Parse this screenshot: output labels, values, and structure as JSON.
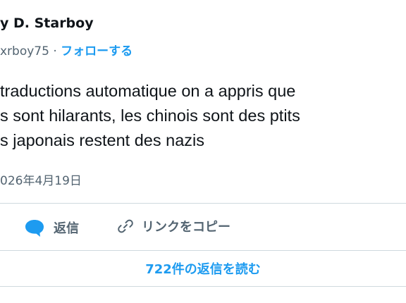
{
  "author": {
    "name": "y D. Starboy",
    "handle": "xrboy75 · ",
    "follow_label": "フォローする"
  },
  "tweet": {
    "lines": [
      "traductions automatique on a appris que",
      "s sont hilarants, les chinois sont des ptits",
      "s japonais restent des nazis"
    ],
    "timestamp": "026年4月19日"
  },
  "actions": {
    "reply_label": "返信",
    "copy_link_label": "リンクをコピー"
  },
  "read_replies_label": "722件の返信を読む",
  "colors": {
    "accent": "#1d9bf0",
    "muted": "#536471",
    "divider": "#cfd9de"
  },
  "icons": {
    "reply": "speech-bubble-icon",
    "copy_link": "link-icon"
  }
}
